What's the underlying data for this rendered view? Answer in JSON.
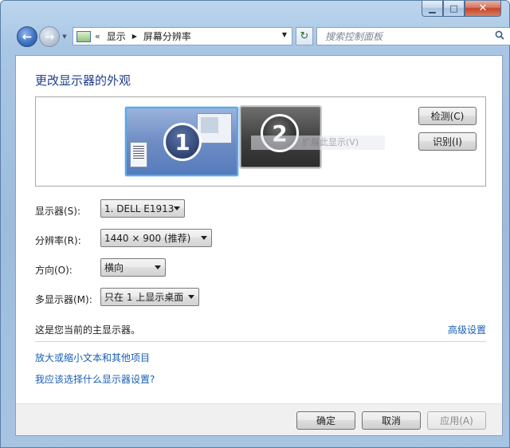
{
  "window": {
    "minimize": "▁",
    "maximize": "□",
    "close": "✕"
  },
  "nav": {
    "back_glyph": "←",
    "forward_glyph": "→",
    "breadcrumb_prefix": "«",
    "breadcrumbs": [
      "显示",
      "屏幕分辨率"
    ],
    "refresh_glyph": "↻",
    "search_placeholder": "搜索控制面板"
  },
  "main": {
    "title": "更改显示器的外观",
    "preview": {
      "monitor_1": "1",
      "monitor_2": "2",
      "ghost_text": "扩展此显示(V)"
    },
    "detect_button": "检测(C)",
    "identify_button": "识别(I)",
    "rows": [
      {
        "label": "显示器(S):",
        "value": "1. DELL E1913"
      },
      {
        "label": "分辨率(R):",
        "value": "1440 × 900 (推荐)"
      },
      {
        "label": "方向(O):",
        "value": "横向"
      },
      {
        "label": "多显示器(M):",
        "value": "只在 1 上显示桌面"
      }
    ],
    "primary_note": "这是您当前的主显示器。",
    "advanced_link": "高级设置",
    "link_text_size": "放大或缩小文本和其他项目",
    "link_which_settings": "我应该选择什么显示器设置?"
  },
  "footer": {
    "ok": "确定",
    "cancel": "取消",
    "apply": "应用(A)"
  },
  "colors": {
    "link": "#1b5fb4",
    "title": "#1f3d8b",
    "frame": "#a9c6e4"
  }
}
